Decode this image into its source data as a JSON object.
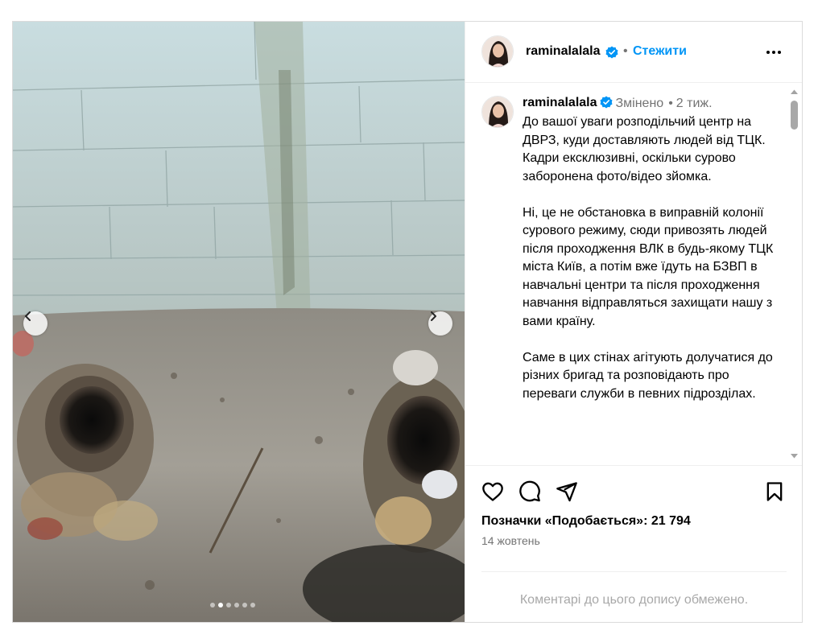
{
  "post": {
    "username": "raminalalala",
    "follow_label": "Стежити",
    "separator": "•",
    "more_label": "More options"
  },
  "caption": {
    "username": "raminalalala",
    "edited_label": "Змінено",
    "dot": "•",
    "time": "2 тиж.",
    "paragraphs": [
      "До вашої уваги розподільчий центр на ДВРЗ, куди доставляють людей від ТЦК. Кадри ексклюзивні, оскільки сурово заборонена фото/відео зйомка.",
      "Ні, це не обстановка в виправній колонії сурового режиму, сюди привозять людей після проходження ВЛК в будь-якому ТЦК міста Київ, а потім вже їдуть на БЗВП в навчальні центри та після проходження навчання відправляться захищати нашу з вами країну.",
      "Саме в цих стінах агітують долучатися до різних бригад та розповідають про переваги служби в певних підрозділах."
    ]
  },
  "carousel": {
    "total_slides": 6,
    "active_slide": 2
  },
  "stats": {
    "likes_label": "Позначки «Подобається»: 21 794",
    "date": "14 жовтень"
  },
  "comments": {
    "limited_text": "Коментарі до цього допису обмежено."
  },
  "colors": {
    "accent": "#0095f6",
    "verified": "#0095f6",
    "secondary_text": "#737373",
    "border": "#dbdbdb"
  },
  "icons": [
    "like-icon",
    "comment-icon",
    "share-icon",
    "save-icon",
    "verified-icon",
    "more-icon",
    "chevron-left-icon",
    "chevron-right-icon"
  ]
}
